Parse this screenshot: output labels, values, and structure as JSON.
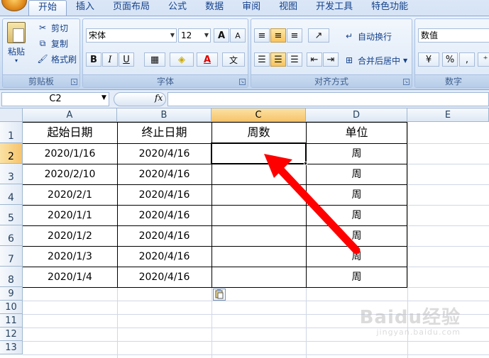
{
  "ribbon": {
    "tabs": [
      "开始",
      "插入",
      "页面布局",
      "公式",
      "数据",
      "审阅",
      "视图",
      "开发工具",
      "特色功能"
    ],
    "clipboard": {
      "paste": "粘贴",
      "cut": "剪切",
      "copy": "复制",
      "format_painter": "格式刷",
      "label": "剪贴板"
    },
    "font": {
      "name": "宋体",
      "size": "12",
      "bold": "B",
      "italic": "I",
      "underline": "U",
      "grow": "A",
      "shrink": "A",
      "label": "字体",
      "wen": "文"
    },
    "alignment": {
      "wrap": "自动换行",
      "merge": "合并后居中",
      "label": "对齐方式"
    },
    "number": {
      "format": "数值",
      "percent": "%",
      "comma": ",",
      "label": "数字"
    }
  },
  "formula_bar": {
    "name_box": "C2",
    "fx": "fx",
    "value": ""
  },
  "columns": [
    "A",
    "B",
    "C",
    "D",
    "E"
  ],
  "rows": [
    "1",
    "2",
    "3",
    "4",
    "5",
    "6",
    "7",
    "8",
    "9",
    "10",
    "11",
    "12",
    "13"
  ],
  "table": {
    "headers": [
      "起始日期",
      "终止日期",
      "周数",
      "单位"
    ],
    "rows": [
      [
        "2020/1/16",
        "2020/4/16",
        "",
        "周"
      ],
      [
        "2020/2/10",
        "2020/4/16",
        "",
        "周"
      ],
      [
        "2020/2/1",
        "2020/4/16",
        "",
        "周"
      ],
      [
        "2020/1/1",
        "2020/4/16",
        "",
        "周"
      ],
      [
        "2020/1/2",
        "2020/4/16",
        "",
        "周"
      ],
      [
        "2020/1/3",
        "2020/4/16",
        "",
        "周"
      ],
      [
        "2020/1/4",
        "2020/4/16",
        "",
        "周"
      ]
    ]
  },
  "watermark": {
    "brand": "Baidu经验",
    "url": "jingyan.baidu.com"
  },
  "colors": {
    "accent": "#ff0000",
    "selected_header": "#f6c46b"
  }
}
